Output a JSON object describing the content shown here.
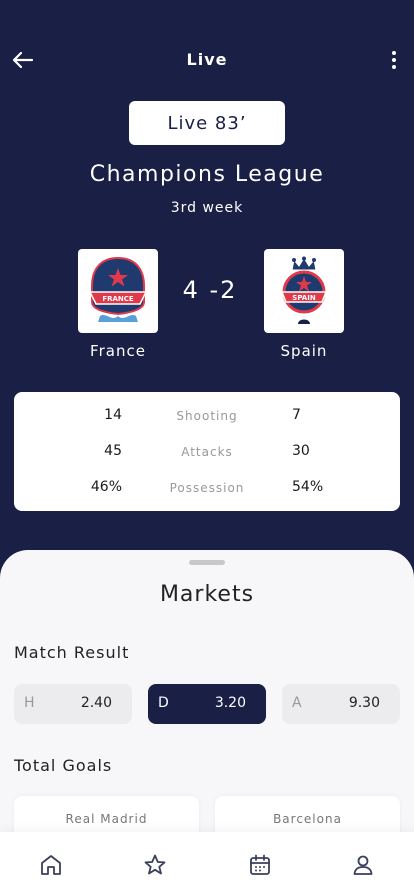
{
  "header": {
    "title": "Live",
    "back_icon": "arrow-left-icon",
    "menu_icon": "more-vertical-icon"
  },
  "match": {
    "status": "Live 83’",
    "league": "Champions League",
    "week": "3rd week",
    "score": "4 -2",
    "home": {
      "name": "France",
      "badge_text": "FRANCE",
      "badge_color": "#1e3a6e",
      "accent": "#e03a4a"
    },
    "away": {
      "name": "Spain",
      "badge_text": "SPAIN",
      "badge_color": "#1e3a6e",
      "accent": "#e03a4a"
    }
  },
  "stats": [
    {
      "home": "14",
      "label": "Shooting",
      "away": "7"
    },
    {
      "home": "45",
      "label": "Attacks",
      "away": "30"
    },
    {
      "home": "46%",
      "label": "Possession",
      "away": "54%"
    }
  ],
  "markets": {
    "title": "Markets",
    "match_result": {
      "title": "Match Result",
      "options": [
        {
          "key": "H",
          "value": "2.40",
          "selected": false
        },
        {
          "key": "D",
          "value": "3.20",
          "selected": true
        },
        {
          "key": "A",
          "value": "9.30",
          "selected": false
        }
      ]
    },
    "total_goals": {
      "title": "Total Goals",
      "teams": [
        "Real Madrid",
        "Barcelona"
      ]
    }
  },
  "nav": [
    "home-icon",
    "star-icon",
    "calendar-icon",
    "user-icon"
  ],
  "colors": {
    "primary": "#1a1f45",
    "sheet": "#f7f7f9",
    "card": "#ffffff"
  }
}
